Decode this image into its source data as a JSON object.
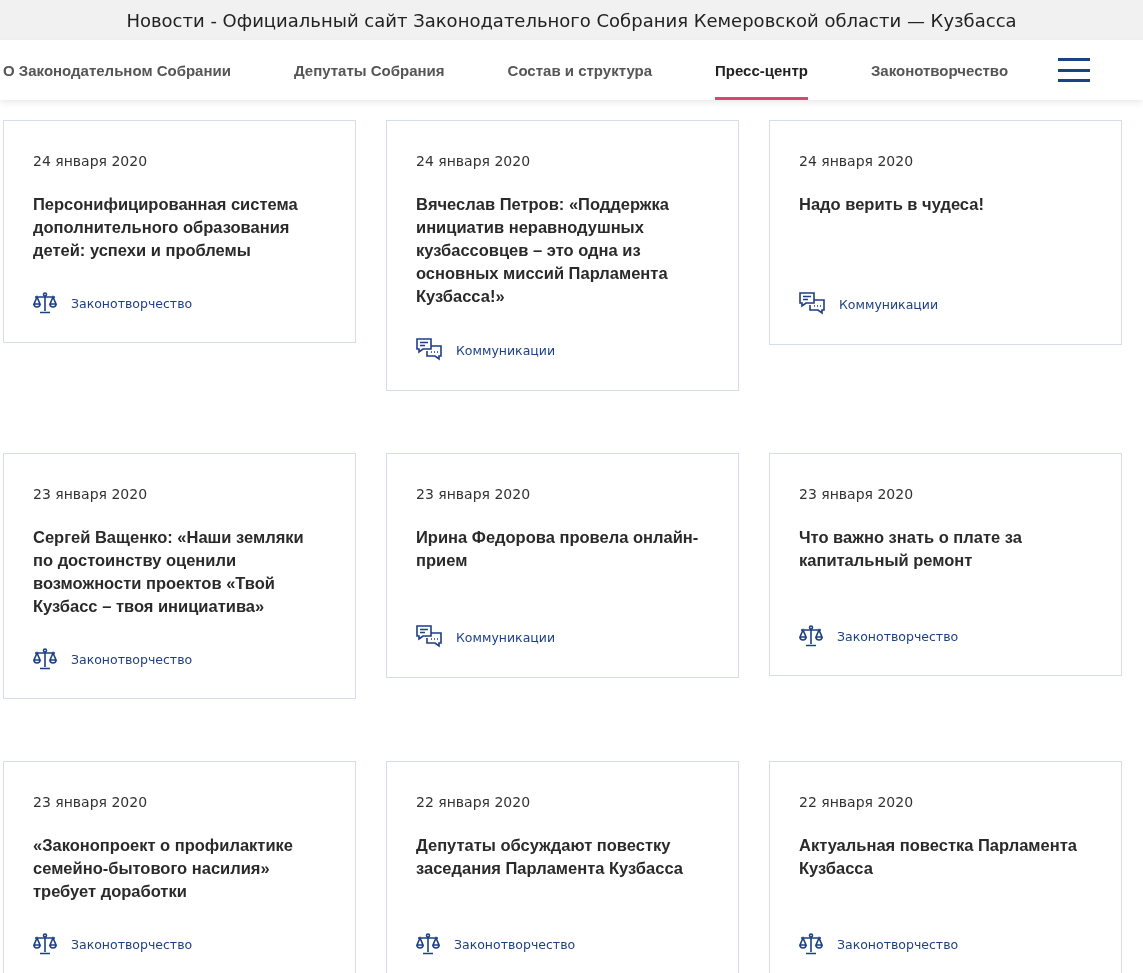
{
  "window": {
    "title": "Новости - Официальный сайт Законодательного Собрания Кемеровской области — Кузбасса"
  },
  "nav": [
    {
      "label": "О Законодательном Собрании",
      "selected": false
    },
    {
      "label": "Депутаты Собрания",
      "selected": false
    },
    {
      "label": "Состав и структура",
      "selected": false
    },
    {
      "label": "Пресс-центр",
      "selected": true
    },
    {
      "label": "Законотворчество",
      "selected": false
    }
  ],
  "news": [
    {
      "date": "24 января 2020",
      "title": "Персонифицированная система дополнительного образования детей: успехи и проблемы",
      "category": "Законотворчество",
      "kind": "law"
    },
    {
      "date": "24 января 2020",
      "title": "Вячеслав Петров: «Поддержка инициатив неравнодушных кузбассовцев – это одна из основных миссий Парламента Кузбасса!»",
      "category": "Коммуникации",
      "kind": "comm"
    },
    {
      "date": "24 января 2020",
      "title": "Надо верить в чудеса!",
      "category": "Коммуникации",
      "kind": "comm"
    },
    {
      "date": "23 января 2020",
      "title": "Сергей Ващенко: «Наши земляки по достоинству оценили возможности проектов «Твой Кузбасс – твоя инициатива»",
      "category": "Законотворчество",
      "kind": "law"
    },
    {
      "date": "23 января 2020",
      "title": "Ирина Федорова провела онлайн-прием",
      "category": "Коммуникации",
      "kind": "comm"
    },
    {
      "date": "23 января 2020",
      "title": "Что важно знать о плате за капитальный ремонт",
      "category": "Законотворчество",
      "kind": "law"
    },
    {
      "date": "23 января 2020",
      "title": "«Законопроект о профилактике семейно-бытового насилия» требует доработки",
      "category": "Законотворчество",
      "kind": "law"
    },
    {
      "date": "22 января 2020",
      "title": "Депутаты обсуждают повестку заседания Парламента Кузбасса",
      "category": "Законотворчество",
      "kind": "law"
    },
    {
      "date": "22 января 2020",
      "title": "Актуальная повестка Парламента Кузбасса",
      "category": "Законотворчество",
      "kind": "law"
    }
  ]
}
